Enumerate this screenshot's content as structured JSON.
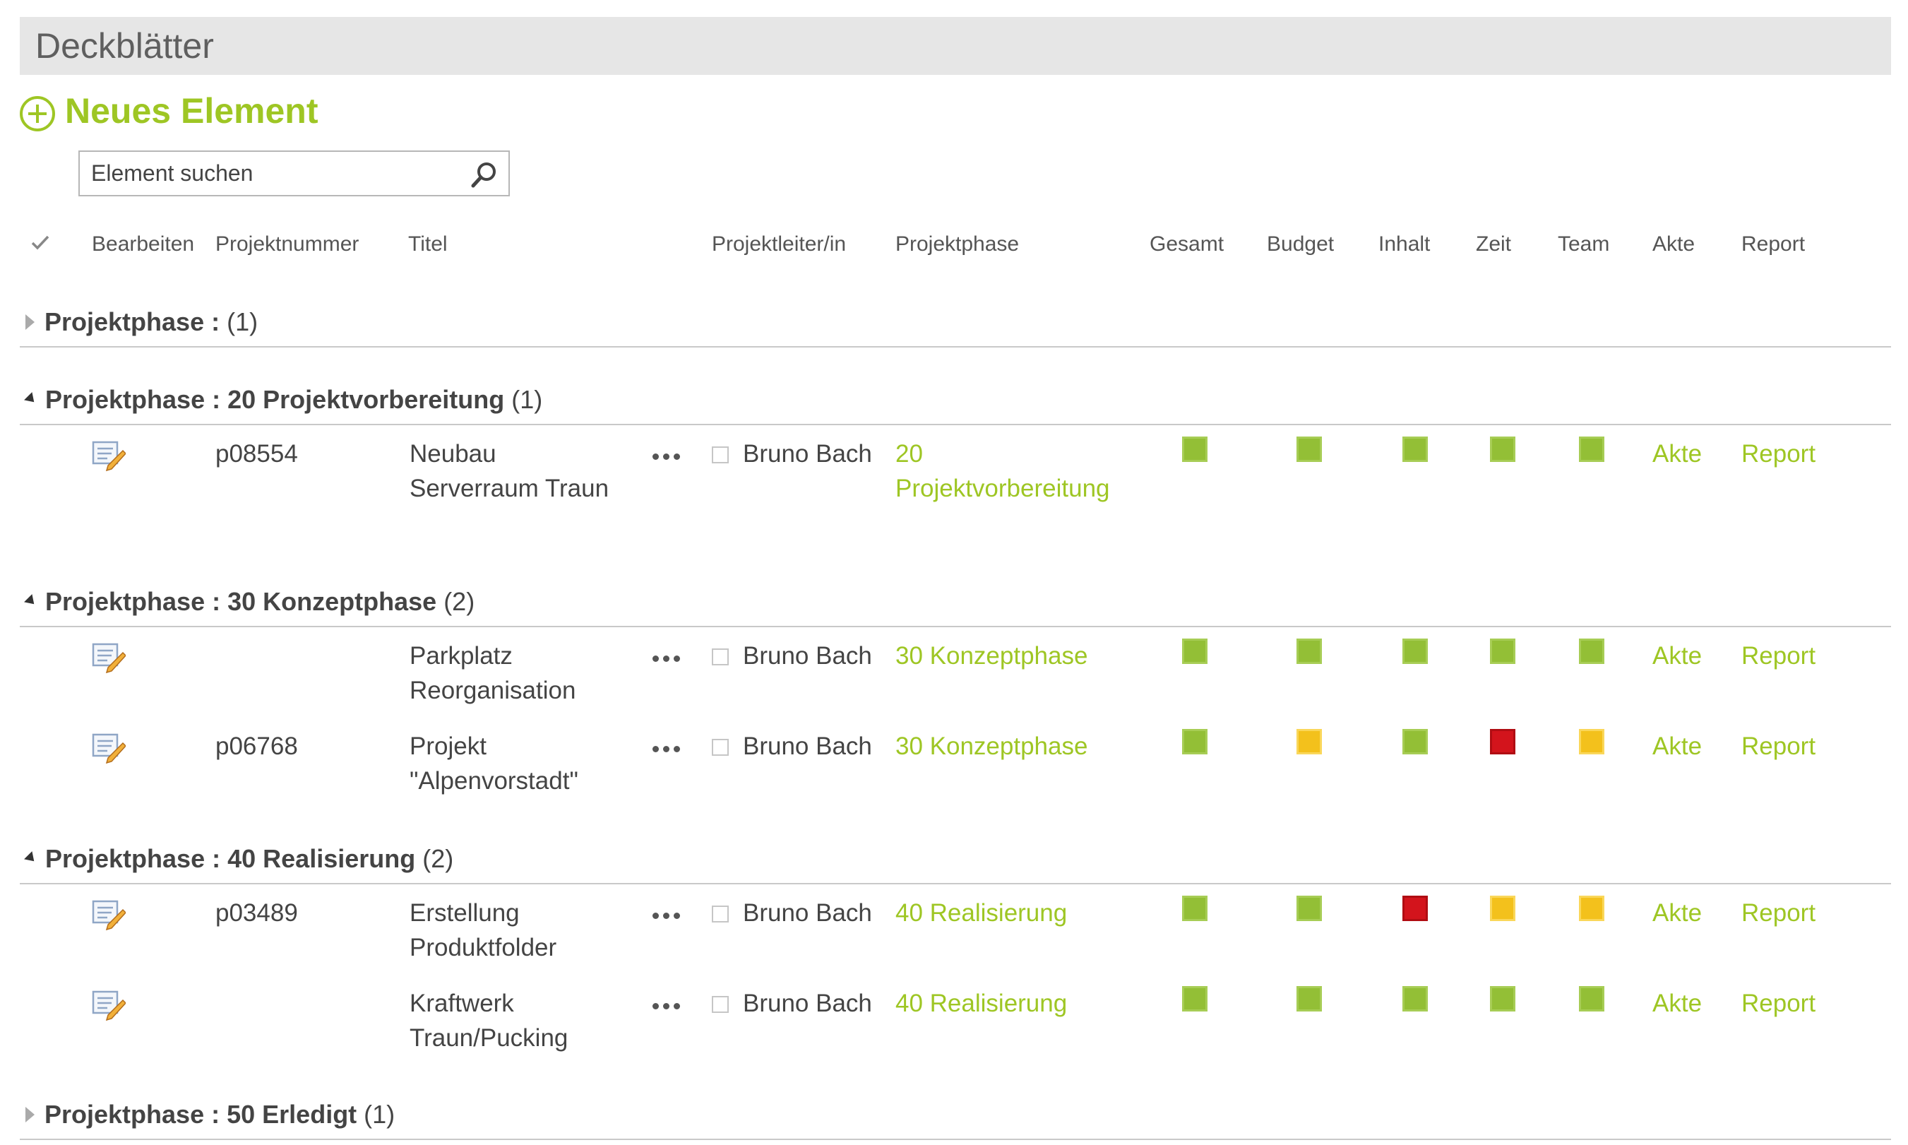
{
  "page": {
    "title": "Deckblätter"
  },
  "toolbar": {
    "new_element_label": "Neues Element"
  },
  "search": {
    "placeholder": "Element suchen"
  },
  "columns": {
    "edit": "Bearbeiten",
    "project_number": "Projektnummer",
    "title": "Titel",
    "leader": "Projektleiter/in",
    "phase": "Projektphase",
    "overall": "Gesamt",
    "budget": "Budget",
    "content": "Inhalt",
    "time": "Zeit",
    "team": "Team",
    "file": "Akte",
    "report": "Report"
  },
  "groups": [
    {
      "label": "Projektphase :",
      "value": "",
      "count": "(1)",
      "expanded": false
    },
    {
      "label": "Projektphase :",
      "value": "20 Projektvorbereitung",
      "count": "(1)",
      "expanded": true
    },
    {
      "label": "Projektphase :",
      "value": "30 Konzeptphase",
      "count": "(2)",
      "expanded": true
    },
    {
      "label": "Projektphase :",
      "value": "40 Realisierung",
      "count": "(2)",
      "expanded": true
    },
    {
      "label": "Projektphase :",
      "value": "50 Erledigt",
      "count": "(1)",
      "expanded": false
    }
  ],
  "rows": [
    {
      "project_number": "p08554",
      "title": "Neubau Serverraum Traun",
      "leader": "Bruno Bach",
      "phase": "20 Projektvorbereitung",
      "status": {
        "overall": "green",
        "budget": "green",
        "content": "green",
        "time": "green",
        "team": "green"
      },
      "file": "Akte",
      "report": "Report"
    },
    {
      "project_number": "",
      "title": "Parkplatz Reorganisation",
      "leader": "Bruno Bach",
      "phase": "30 Konzeptphase",
      "status": {
        "overall": "green",
        "budget": "green",
        "content": "green",
        "time": "green",
        "team": "green"
      },
      "file": "Akte",
      "report": "Report"
    },
    {
      "project_number": "p06768",
      "title": "Projekt \"Alpenvorstadt\"",
      "leader": "Bruno Bach",
      "phase": "30 Konzeptphase",
      "status": {
        "overall": "green",
        "budget": "yellow",
        "content": "green",
        "time": "red",
        "team": "yellow"
      },
      "file": "Akte",
      "report": "Report"
    },
    {
      "project_number": "p03489",
      "title": "Erstellung Produktfolder",
      "leader": "Bruno Bach",
      "phase": "40 Realisierung",
      "status": {
        "overall": "green",
        "budget": "green",
        "content": "red",
        "time": "yellow",
        "team": "yellow"
      },
      "file": "Akte",
      "report": "Report"
    },
    {
      "project_number": "",
      "title": "Kraftwerk Traun/Pucking",
      "leader": "Bruno Bach",
      "phase": "40 Realisierung",
      "status": {
        "overall": "green",
        "budget": "green",
        "content": "green",
        "time": "green",
        "team": "green"
      },
      "file": "Akte",
      "report": "Report"
    }
  ],
  "colors": {
    "accent": "#9ec624",
    "green": "#93bf36",
    "yellow": "#f3c11c",
    "red": "#d3141c"
  }
}
